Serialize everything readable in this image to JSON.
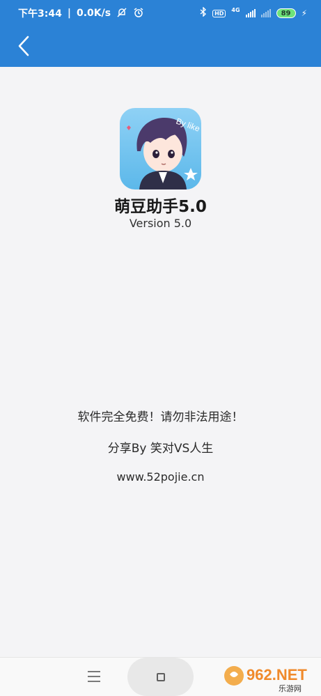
{
  "status": {
    "time": "下午3:44",
    "speed": "0.0K/s",
    "net_type": "4G",
    "hd": "HD",
    "battery": "89"
  },
  "app": {
    "title": "萌豆助手5.0",
    "version": "Version 5.0",
    "icon_text": "By like"
  },
  "info": {
    "line1": "软件完全免费！请勿非法用途！",
    "line2": "分享By 笑对VS人生",
    "line3": "www.52pojie.cn"
  },
  "watermark": {
    "text": "962.NET",
    "sub": "乐游网"
  },
  "colors": {
    "header": "#2b82d6",
    "background": "#f4f4f6"
  }
}
